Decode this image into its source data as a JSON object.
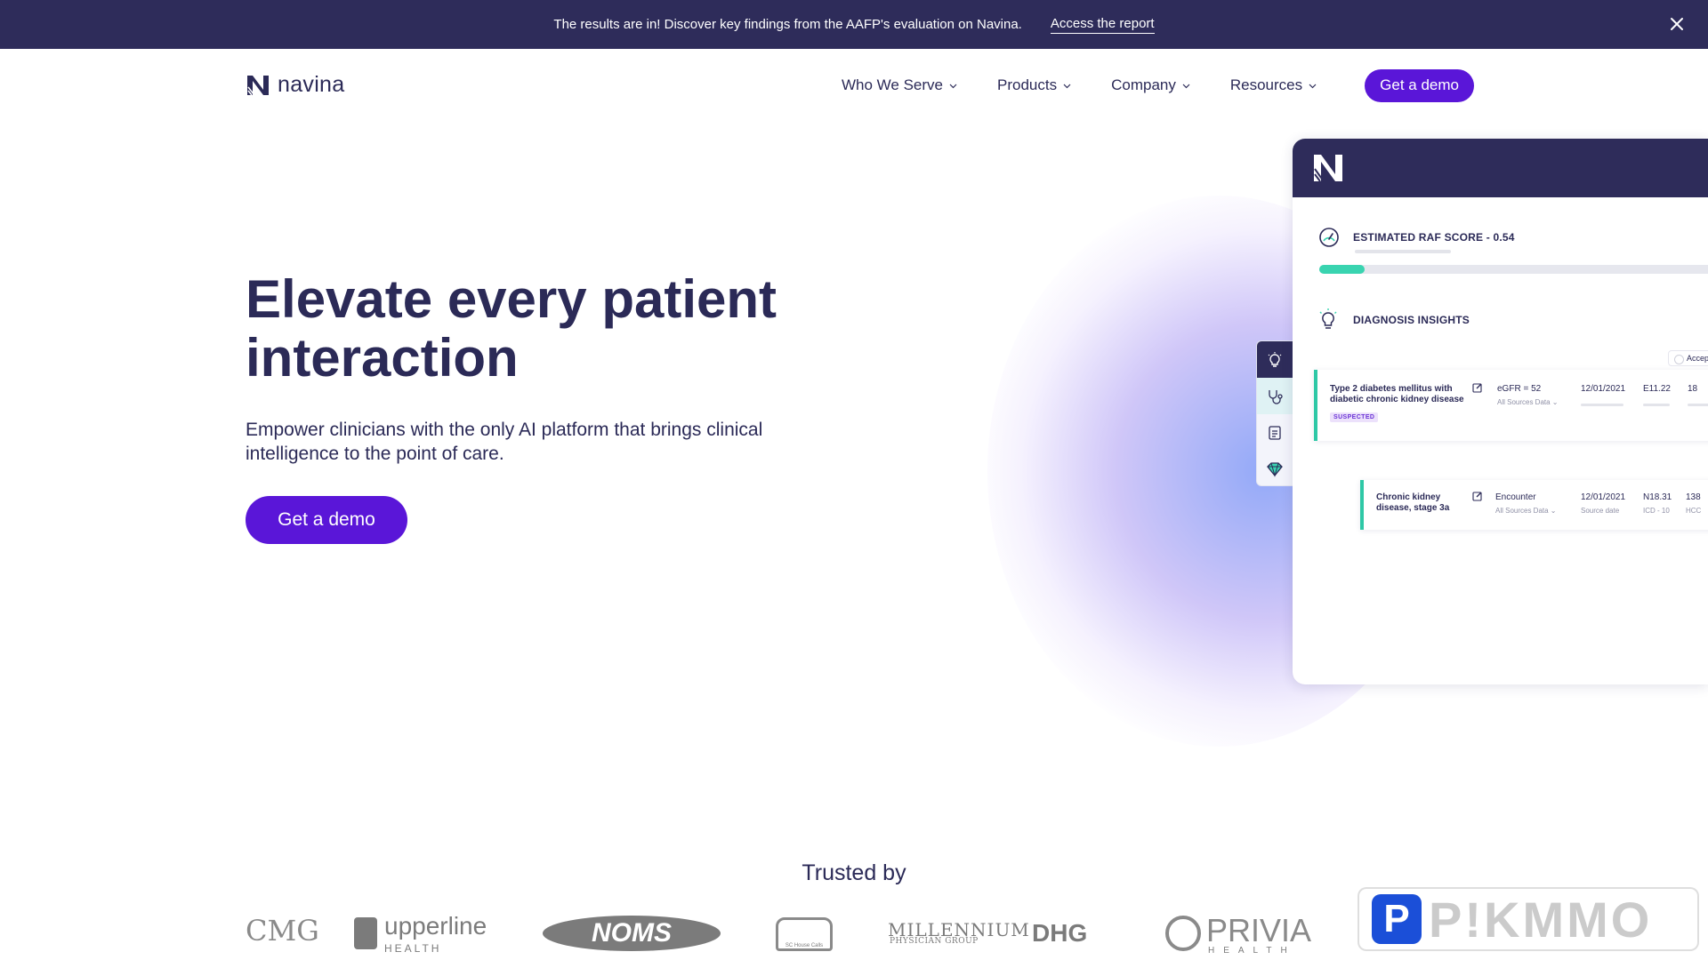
{
  "announcement": {
    "message": "The results are in! Discover key findings from the AAFP's evaluation on Navina.",
    "link": "Access the report"
  },
  "header": {
    "logo_text": "navina",
    "nav": [
      {
        "label": "Who We Serve"
      },
      {
        "label": "Products"
      },
      {
        "label": "Company"
      },
      {
        "label": "Resources"
      }
    ],
    "cta": "Get a demo"
  },
  "hero": {
    "title": "Elevate every patient interaction",
    "subtitle": "Empower clinicians with the only AI platform that brings clinical intelligence to the point of care.",
    "cta": "Get a demo"
  },
  "product_card": {
    "raf_label": "ESTIMATED RAF SCORE - 0.54",
    "raf_fill_fraction": 0.11,
    "diagnosis_label": "DIAGNOSIS INSIGHTS",
    "accept_label": "Accep",
    "rows": [
      {
        "title": "Type 2 diabetes mellitus with diabetic chronic kidney disease",
        "badge": "SUSPECTED",
        "lab": "eGFR = 52",
        "source": "All Sources Data ⌄",
        "date": "12/01/2021",
        "code": "E11.22",
        "extra": "18"
      },
      {
        "title": "Chronic kidney disease, stage 3a",
        "lab": "Encounter",
        "source": "All Sources Data ⌄",
        "date": "12/01/2021",
        "date_label": "Source date",
        "code": "N18.31",
        "code_label": "ICD - 10",
        "extra": "138",
        "extra_label": "HCC"
      }
    ]
  },
  "trusted": {
    "heading": "Trusted by",
    "logos": [
      "CMG",
      "upperline",
      "HEALTH",
      "NOMS",
      "SC House Calls",
      "MILLENNIUM",
      "PHYSICIAN GROUP",
      "DHG",
      "PRIVIA",
      "HEALTH"
    ]
  },
  "watermark": "P!KMMO",
  "colors": {
    "navy": "#2e2c5a",
    "purple": "#5a16d8",
    "teal": "#39d4b0"
  }
}
